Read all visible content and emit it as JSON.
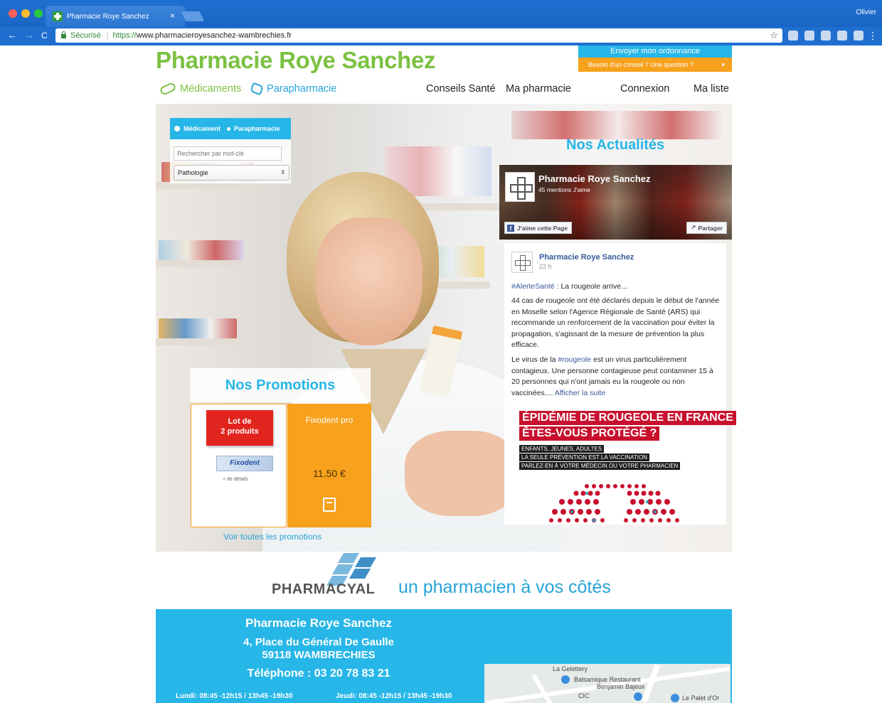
{
  "browser": {
    "tab_title": "Pharmacie Roye Sanchez",
    "tab_close": "×",
    "user": "Olivier",
    "secure_label": "Sécurisé",
    "url_protocol": "https://",
    "url_rest": "www.pharmacieroyesanchez-wambrechies.fr",
    "back": "←",
    "forward": "→",
    "reload": "C",
    "star": "☆",
    "menu": "⋮"
  },
  "header": {
    "title": "Pharmacie Roye Sanchez",
    "cta_primary": "Envoyer mon ordonnance",
    "cta_secondary": "Besoin d'un conseil ? Une question ?",
    "cta_caret": "▾"
  },
  "nav": {
    "medicaments": "Médicaments",
    "parapharmacie": "Parapharmacie",
    "conseils": "Conseils Santé",
    "ma_pharmacie": "Ma pharmacie",
    "connexion": "Connexion",
    "ma_liste": "Ma liste"
  },
  "search": {
    "radio_1": "Médicament",
    "radio_2": "Parapharmacie",
    "placeholder": "Rechercher par mot-clé",
    "select_value": "Pathologie",
    "select_arrow": "⇕"
  },
  "promotions": {
    "title": "Nos Promotions",
    "badge_line1": "Lot de",
    "badge_line2": "2 produits",
    "product_brand": "Fixodent",
    "more": "+ de détails",
    "product_name": "Fixodent pro",
    "price": "11.50 €",
    "see_all": "Voir toutes les promotions"
  },
  "news": {
    "title": "Nos Actualités",
    "page_name": "Pharmacie Roye Sanchez",
    "likes": "45 mentions J'aime",
    "like_button": "J'aime cette Page",
    "fb_f": "f",
    "share_button": "Partager",
    "share_glyph": "↗",
    "post_author": "Pharmacie Roye Sanchez",
    "post_time": "22 h",
    "hashtag": "#AlerteSanté",
    "intro_rest": " : La rougeole arrive...",
    "paragraph1": "44 cas de rougeole ont été déclarés depuis le début de l'année en Moselle selon l'Agence Régionale de Santé (ARS) qui recommande un renforcement de la vaccination pour éviter la propagation, s'agissant de la mesure de prévention la plus efficace.",
    "p2_start": "Le virus de la ",
    "p2_tag": "#rougeole",
    "p2_rest": " est un virus particulièrement contagieux. Une personne contagieuse peut contaminer 15 à 20 personnes qui n'ont jamais eu la rougeole ou non vaccinées.... ",
    "read_more": "Afficher la suite",
    "poster_line1": "ÉPIDÉMIE DE ROUGEOLE EN FRANCE",
    "poster_line2": "ÊTES-VOUS PROTÉGÉ ?",
    "poster_small1": "ENFANTS, JEUNES, ADULTES",
    "poster_small2": "LA SEULE PRÉVENTION EST LA VACCINATION",
    "poster_small3": "PARLEZ-EN À VOTRE MÉDECIN OU VOTRE PHARMACIEN"
  },
  "pharmacyal": {
    "brand": "PHARMACYAL",
    "tagline": "un pharmacien à vos côtés"
  },
  "footer": {
    "name": "Pharmacie Roye Sanchez",
    "address1": "4, Place du Général De Gaulle",
    "address2": "59118 WAMBRECHIES",
    "phone": "Téléphone : 03 20 78 83 21",
    "hours_left": "Lundi: 08:45 -12h15 / 13h45 -19h30",
    "hours_right": "Jeudi: 08:45 -12h15 / 13h45 -19h30",
    "map_label_1": "La Gelettery",
    "map_label_2": "Balsamique Restaurant",
    "map_label_3": "Benjamin Bajeux",
    "map_label_4": "CIC",
    "map_label_5": "Le Palet d'Or"
  },
  "colors": {
    "brand_green": "#7cc142",
    "brand_blue": "#27b6e8",
    "brand_orange": "#f7a11d",
    "alert_red": "#c8102e",
    "chrome_blue": "#1f6fd0"
  }
}
